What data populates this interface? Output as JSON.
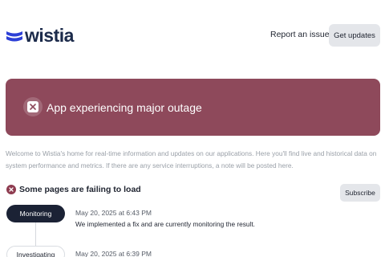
{
  "header": {
    "brand": "wistia",
    "report_link": "Report an issue",
    "get_updates_label": "Get updates"
  },
  "banner": {
    "title": "App experiencing major outage",
    "icon": "close-icon",
    "color": "#8e495b"
  },
  "intro_text": "Welcome to Wistia's home for real-time information and updates on our applications. Here you'll find live and historical data on system performance and metrics. If there are any service interruptions, a note will be posted here.",
  "incident": {
    "title": "Some pages are failing to load",
    "icon": "error-icon",
    "subscribe_label": "Subscribe",
    "updates": [
      {
        "status": "Monitoring",
        "date": "May 20, 2025 at 6:43 PM",
        "message": "We implemented a fix and are currently monitoring the result."
      },
      {
        "status": "Investigating",
        "date": "May 20, 2025 at 6:39 PM",
        "message": ""
      }
    ]
  }
}
